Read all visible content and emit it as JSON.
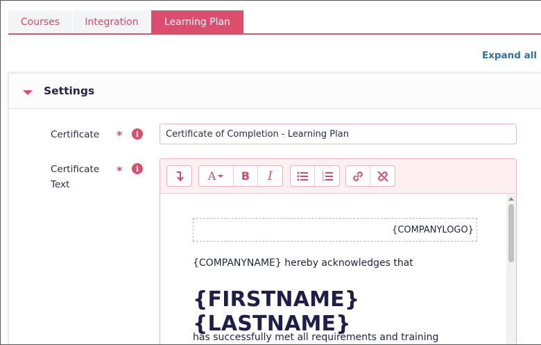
{
  "tabs": [
    {
      "label": "Courses"
    },
    {
      "label": "Integration"
    },
    {
      "label": "Learning Plan"
    }
  ],
  "active_tab": "Learning Plan",
  "expand_all_label": "Expand all",
  "settings": {
    "title": "Settings",
    "certificate": {
      "label": "Certificate",
      "required_mark": "*",
      "info_icon": "i",
      "value": "Certificate of Completion - Learning Plan"
    },
    "certificate_text": {
      "label_line1": "Certificate",
      "label_line2": "Text",
      "required_mark": "*",
      "info_icon": "i"
    }
  },
  "editor": {
    "toolbar": {
      "font_color_label": "A"
    },
    "content": {
      "logo_placeholder": "{COMPANYLOGO}",
      "line1": "{COMPANYNAME} hereby acknowledges that",
      "name_heading": "{FIRSTNAME} {LASTNAME}",
      "line2": "has successfully met all requirements and training"
    }
  },
  "colors": {
    "accent": "#dc4e6e",
    "link": "#2f6fa6",
    "text": "#22224a"
  },
  "icons": [
    "caret-down-icon",
    "info-icon",
    "insert-field-icon",
    "font-color-icon",
    "bold-icon",
    "italic-icon",
    "bulleted-list-icon",
    "numbered-list-icon",
    "link-icon",
    "unlink-icon"
  ]
}
